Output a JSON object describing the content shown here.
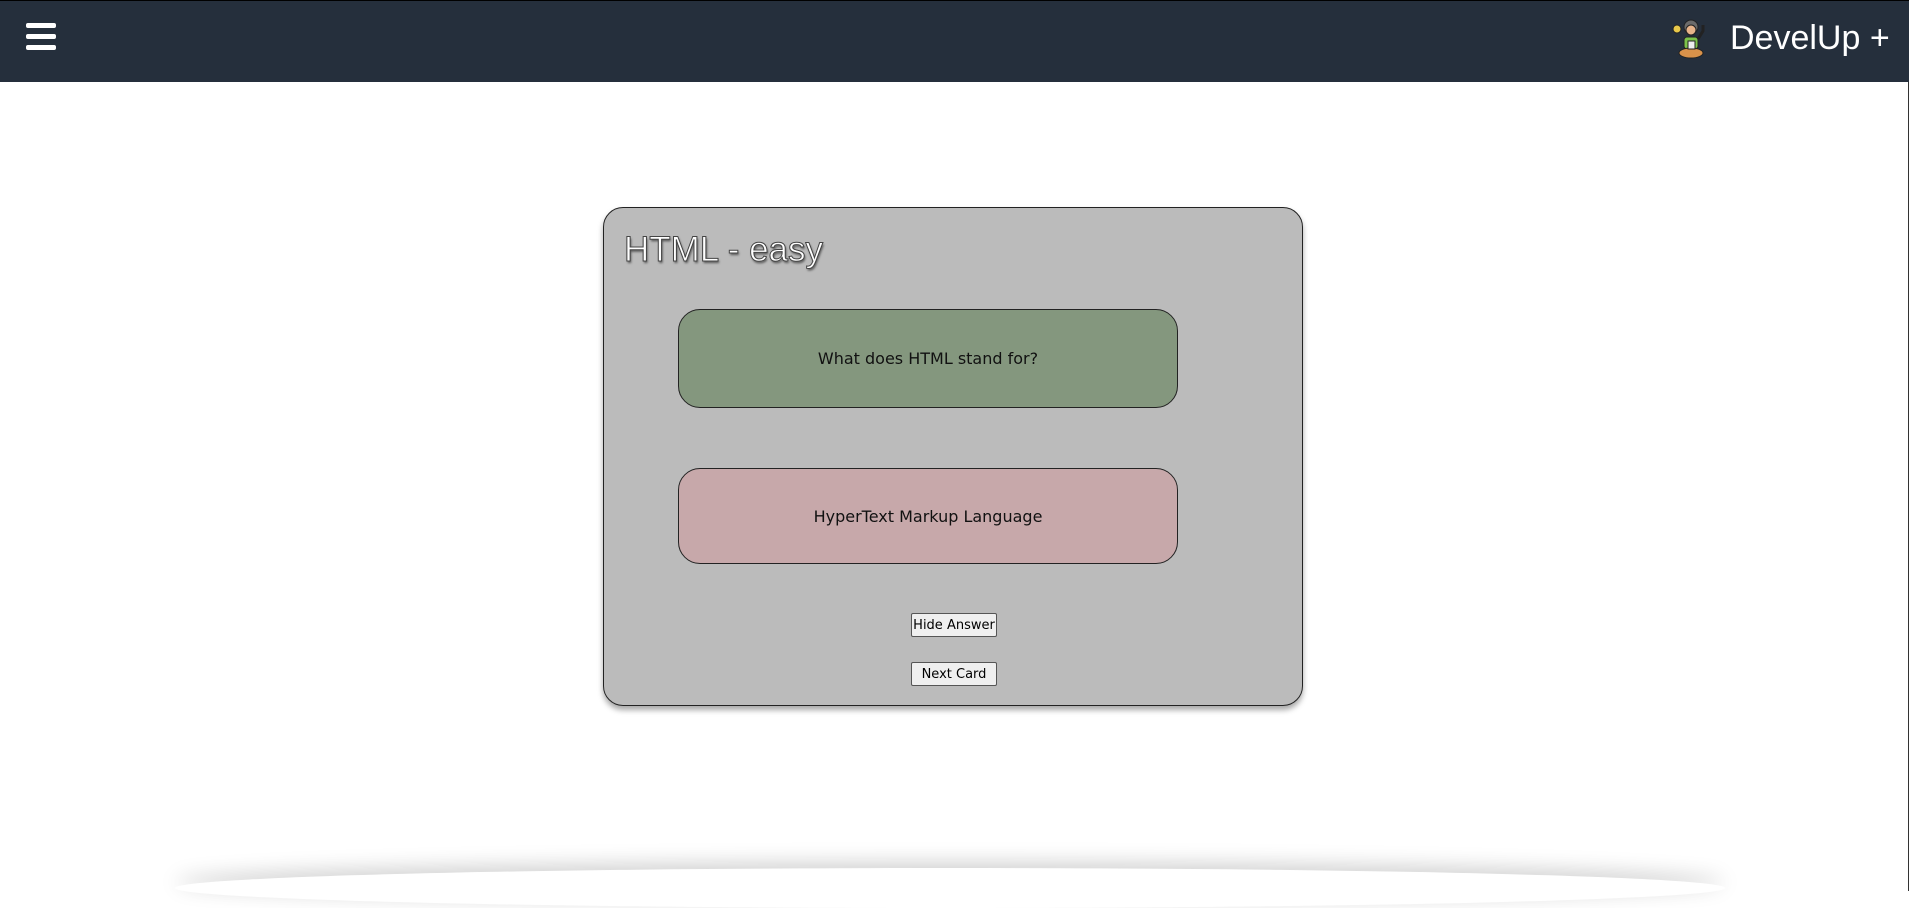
{
  "header": {
    "brand": "DevelUp +",
    "menu_icon": "hamburger-icon",
    "logo_icon": "developer-mascot-icon"
  },
  "card": {
    "title": "HTML - easy",
    "question": "What does HTML stand for?",
    "answer": "HyperText Markup Language",
    "hide_answer_label": "Hide Answer",
    "next_card_label": "Next Card"
  },
  "colors": {
    "header": "#252f3c",
    "card": "#bbbbbb",
    "question": "#84977e",
    "answer": "#c7a8aa"
  }
}
